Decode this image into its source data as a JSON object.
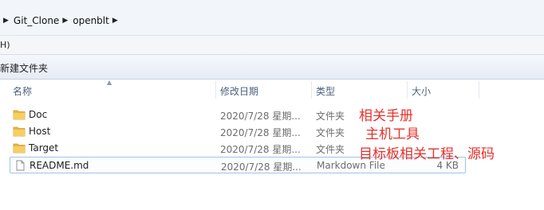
{
  "breadcrumb": {
    "items": [
      "Git_Clone",
      "openblt"
    ]
  },
  "menubar": {
    "fragment": "H)"
  },
  "commandbar": {
    "new_folder": "新建文件夹"
  },
  "columns": {
    "name": "名称",
    "date": "修改日期",
    "type": "类型",
    "size": "大小"
  },
  "files": [
    {
      "name": "Doc",
      "date": "2020/7/28 星期...",
      "type": "文件夹",
      "size": "",
      "icon": "folder-icon"
    },
    {
      "name": "Host",
      "date": "2020/7/28 星期...",
      "type": "文件夹",
      "size": "",
      "icon": "folder-icon"
    },
    {
      "name": "Target",
      "date": "2020/7/28 星期...",
      "type": "文件夹",
      "size": "",
      "icon": "folder-icon"
    },
    {
      "name": "README.md",
      "date": "2020/7/28 星期...",
      "type": "Markdown File",
      "size": "4 KB",
      "icon": "file-icon"
    }
  ],
  "annotations": [
    "相关手册",
    "主机工具",
    "目标板相关工程、源码"
  ],
  "colors": {
    "annotation": "#e8302a",
    "folder": "#e8b840",
    "selection_border": "#9fc3e6"
  }
}
